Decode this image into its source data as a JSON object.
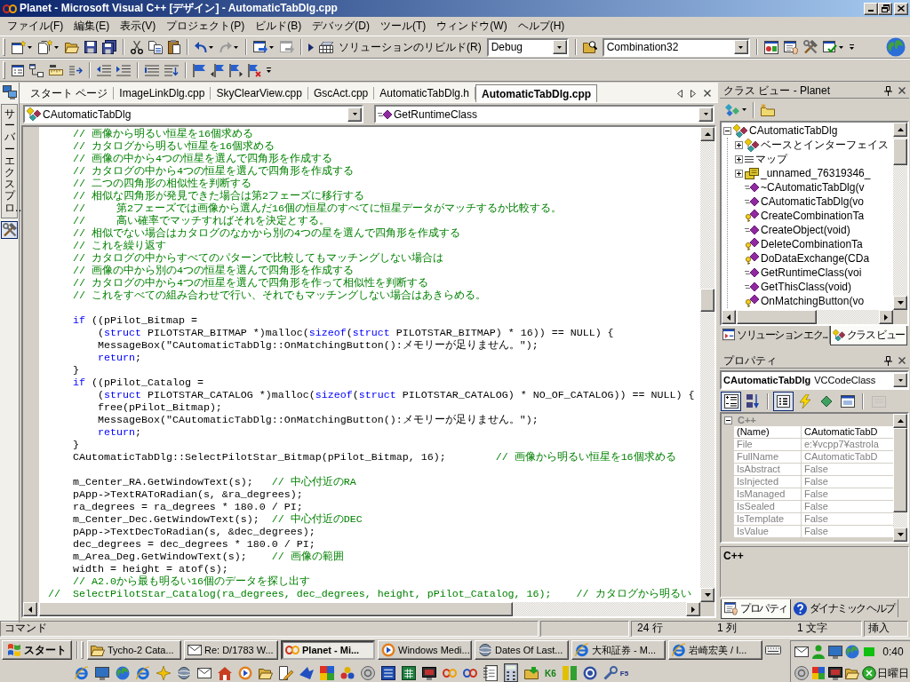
{
  "window": {
    "title": "Planet - Microsoft Visual C++ [デザイン] - AutomaticTabDlg.cpp"
  },
  "menu": [
    "ファイル(F)",
    "編集(E)",
    "表示(V)",
    "プロジェクト(P)",
    "ビルド(B)",
    "デバッグ(D)",
    "ツール(T)",
    "ウィンドウ(W)",
    "ヘルプ(H)"
  ],
  "toolbar": {
    "rebuild": "ソリューションのリビルド(R)",
    "configuration": "Debug",
    "find": "Combination32"
  },
  "side_tab": "サーバーエクスプロ…",
  "editor": {
    "tabs": [
      {
        "label": "スタート ページ",
        "selected": false
      },
      {
        "label": "ImageLinkDlg.cpp",
        "selected": false
      },
      {
        "label": "SkyClearView.cpp",
        "selected": false
      },
      {
        "label": "GscAct.cpp",
        "selected": false
      },
      {
        "label": "AutomaticTabDlg.h",
        "selected": false
      },
      {
        "label": "AutomaticTabDlg.cpp",
        "selected": true
      }
    ],
    "class_combo": "CAutomaticTabDlg",
    "member_combo": "GetRuntimeClass",
    "code_blocks": [
      {
        "lines": [
          {
            "segments": [
              {
                "kind": "comment",
                "text": "    // 画像から明るい恒星を16個求める"
              }
            ]
          },
          {
            "segments": [
              {
                "kind": "comment",
                "text": "    // カタログから明るい恒星を16個求める"
              }
            ]
          },
          {
            "segments": [
              {
                "kind": "comment",
                "text": "    // 画像の中から4つの恒星を選んで四角形を作成する"
              }
            ]
          },
          {
            "segments": [
              {
                "kind": "comment",
                "text": "    // カタログの中から4つの恒星を選んで四角形を作成する"
              }
            ]
          },
          {
            "segments": [
              {
                "kind": "comment",
                "text": "    // 二つの四角形の相似性を判断する"
              }
            ]
          },
          {
            "segments": [
              {
                "kind": "comment",
                "text": "    // 相似な四角形が発見できた場合は第2フェーズに移行する"
              }
            ]
          },
          {
            "segments": [
              {
                "kind": "comment",
                "text": "    //     第2フェーズでは画像から選んだ16個の恒星のすべてに恒星データがマッチするか比較する。"
              }
            ]
          },
          {
            "segments": [
              {
                "kind": "comment",
                "text": "    //     高い確率でマッチすればそれを決定とする。"
              }
            ]
          },
          {
            "segments": [
              {
                "kind": "comment",
                "text": "    // 相似でない場合はカタログのなかから別の4つの星を選んで四角形を作成する"
              }
            ]
          },
          {
            "segments": [
              {
                "kind": "comment",
                "text": "    // これを繰り返す"
              }
            ]
          },
          {
            "segments": [
              {
                "kind": "comment",
                "text": "    // カタログの中からすべてのパターンで比較してもマッチングしない場合は"
              }
            ]
          },
          {
            "segments": [
              {
                "kind": "comment",
                "text": "    // 画像の中から別の4つの恒星を選んで四角形を作成する"
              }
            ]
          },
          {
            "segments": [
              {
                "kind": "comment",
                "text": "    // カタログの中から4つの恒星を選んで四角形を作って相似性を判断する"
              }
            ]
          },
          {
            "segments": [
              {
                "kind": "comment",
                "text": "    // これをすべての組み合わせで行い、それでもマッチングしない場合はあきらめる。"
              }
            ]
          }
        ]
      },
      {
        "lines": [
          {
            "segments": [
              {
                "kind": "keyword",
                "text": "    if"
              },
              {
                "kind": "code",
                "text": " ((pPilot_Bitmap ="
              }
            ]
          },
          {
            "segments": [
              {
                "kind": "code",
                "text": "        ("
              },
              {
                "kind": "keyword",
                "text": "struct"
              },
              {
                "kind": "code",
                "text": " PILOTSTAR_BITMAP *)malloc("
              },
              {
                "kind": "keyword",
                "text": "sizeof"
              },
              {
                "kind": "code",
                "text": "("
              },
              {
                "kind": "keyword",
                "text": "struct"
              },
              {
                "kind": "code",
                "text": " PILOTSTAR_BITMAP) * 16)) == NULL) {"
              }
            ]
          },
          {
            "segments": [
              {
                "kind": "code",
                "text": "        MessageBox(\"CAutomaticTabDlg::OnMatchingButton():メモリーが足りません。\");"
              }
            ]
          },
          {
            "segments": [
              {
                "kind": "keyword",
                "text": "        return"
              },
              {
                "kind": "code",
                "text": ";"
              }
            ]
          },
          {
            "segments": [
              {
                "kind": "code",
                "text": "    }"
              }
            ]
          },
          {
            "segments": [
              {
                "kind": "keyword",
                "text": "    if"
              },
              {
                "kind": "code",
                "text": " ((pPilot_Catalog ="
              }
            ]
          },
          {
            "segments": [
              {
                "kind": "code",
                "text": "        ("
              },
              {
                "kind": "keyword",
                "text": "struct"
              },
              {
                "kind": "code",
                "text": " PILOTSTAR_CATALOG *)malloc("
              },
              {
                "kind": "keyword",
                "text": "sizeof"
              },
              {
                "kind": "code",
                "text": "("
              },
              {
                "kind": "keyword",
                "text": "struct"
              },
              {
                "kind": "code",
                "text": " PILOTSTAR_CATALOG) * NO_OF_CATALOG)) == NULL) {"
              }
            ]
          },
          {
            "segments": [
              {
                "kind": "code",
                "text": "        free(pPilot_Bitmap);"
              }
            ]
          },
          {
            "segments": [
              {
                "kind": "code",
                "text": "        MessageBox(\"CAutomaticTabDlg::OnMatchingButton():メモリーが足りません。\");"
              }
            ]
          },
          {
            "segments": [
              {
                "kind": "keyword",
                "text": "        return"
              },
              {
                "kind": "code",
                "text": ";"
              }
            ]
          },
          {
            "segments": [
              {
                "kind": "code",
                "text": "    }"
              }
            ]
          },
          {
            "segments": [
              {
                "kind": "code",
                "text": "    CAutomaticTabDlg::SelectPilotStar_Bitmap(pPilot_Bitmap, 16);        "
              },
              {
                "kind": "comment",
                "text": "// 画像から明るい恒星を16個求める"
              }
            ]
          }
        ]
      },
      {
        "lines": [
          {
            "segments": [
              {
                "kind": "code",
                "text": "    m_Center_RA.GetWindowText(s);   "
              },
              {
                "kind": "comment",
                "text": "// 中心付近のRA"
              }
            ]
          },
          {
            "segments": [
              {
                "kind": "code",
                "text": "    pApp->TextRAToRadian(s, &ra_degrees);"
              }
            ]
          },
          {
            "segments": [
              {
                "kind": "code",
                "text": "    ra_degrees = ra_degrees * 180.0 / PI;"
              }
            ]
          },
          {
            "segments": [
              {
                "kind": "code",
                "text": "    m_Center_Dec.GetWindowText(s);  "
              },
              {
                "kind": "comment",
                "text": "// 中心付近のDEC"
              }
            ]
          },
          {
            "segments": [
              {
                "kind": "code",
                "text": "    pApp->TextDecToRadian(s, &dec_degrees);"
              }
            ]
          },
          {
            "segments": [
              {
                "kind": "code",
                "text": "    dec_degrees = dec_degrees * 180.0 / PI;"
              }
            ]
          },
          {
            "segments": [
              {
                "kind": "code",
                "text": "    m_Area_Deg.GetWindowText(s);    "
              },
              {
                "kind": "comment",
                "text": "// 画像の範囲"
              }
            ]
          },
          {
            "segments": [
              {
                "kind": "code",
                "text": "    width = height = atof(s);"
              }
            ]
          },
          {
            "segments": [
              {
                "kind": "comment",
                "text": "    // A2.0から最も明るい16個のデータを探し出す"
              }
            ]
          },
          {
            "segments": [
              {
                "kind": "comment",
                "text": "//  SelectPilotStar_Catalog(ra_degrees, dec_degrees, height, pPilot_Catalog, 16);    // カタログから明るい"
              }
            ]
          }
        ]
      }
    ]
  },
  "class_view": {
    "title": "クラス ビュー - Planet",
    "tree": [
      {
        "label": "CAutomaticTabDlg",
        "kind": "class",
        "expanded": true,
        "children": [
          {
            "label": "ベースとインターフェイス",
            "kind": "bases",
            "expanded": false
          },
          {
            "label": "マップ",
            "kind": "map",
            "expanded": false
          },
          {
            "label": "_unnamed_76319346_",
            "kind": "struct",
            "expanded": false
          },
          {
            "label": "~CAutomaticTabDlg(v",
            "kind": "method"
          },
          {
            "label": "CAutomaticTabDlg(vo",
            "kind": "method"
          },
          {
            "label": "CreateCombinationTa",
            "kind": "protected_method"
          },
          {
            "label": "CreateObject(void)",
            "kind": "method"
          },
          {
            "label": "DeleteCombinationTa",
            "kind": "protected_method"
          },
          {
            "label": "DoDataExchange(CDa",
            "kind": "protected_method"
          },
          {
            "label": "GetRuntimeClass(voi",
            "kind": "method"
          },
          {
            "label": "GetThisClass(void)",
            "kind": "method"
          },
          {
            "label": "OnMatchingButton(vo",
            "kind": "protected_method"
          }
        ]
      }
    ],
    "tabs": [
      {
        "label": "ソリューション エク...",
        "selected": false
      },
      {
        "label": "クラス ビュー",
        "selected": true
      }
    ]
  },
  "properties": {
    "title": "プロパティ",
    "object_name": "CAutomaticTabDlg",
    "object_type": "VCCodeClass",
    "tools": [
      {
        "selected": true,
        "disabled": false
      },
      {
        "selected": false,
        "disabled": false
      },
      {
        "selected": true,
        "disabled": false
      },
      {
        "selected": false,
        "disabled": false
      },
      {
        "selected": false,
        "disabled": false
      },
      {
        "selected": false,
        "disabled": false
      },
      {
        "selected": false,
        "disabled": true
      }
    ],
    "category": {
      "label": "C++",
      "expanded": true
    },
    "rows": [
      {
        "name": "(Name)",
        "value": "CAutomaticTabD",
        "readonly": false
      },
      {
        "name": "File",
        "value": "e:¥vcpp7¥astrola",
        "readonly": true
      },
      {
        "name": "FullName",
        "value": "CAutomaticTabD",
        "readonly": true
      },
      {
        "name": "IsAbstract",
        "value": "False",
        "readonly": true
      },
      {
        "name": "IsInjected",
        "value": "False",
        "readonly": true
      },
      {
        "name": "IsManaged",
        "value": "False",
        "readonly": true
      },
      {
        "name": "IsSealed",
        "value": "False",
        "readonly": true
      },
      {
        "name": "IsTemplate",
        "value": "False",
        "readonly": true
      },
      {
        "name": "IsValue",
        "value": "False",
        "readonly": true
      }
    ],
    "description": "C++",
    "tabs": [
      {
        "label": "プロパティ",
        "selected": true
      },
      {
        "label": "ダイナミック ヘルプ",
        "selected": false
      }
    ]
  },
  "status_bar": {
    "message": "コマンド",
    "line": "24 行",
    "column": "1 列",
    "char": "1 文字",
    "mode": "挿入"
  },
  "taskbar": {
    "start": "スタート",
    "tasks": [
      {
        "label": "Tycho-2 Cata...",
        "selected": false
      },
      {
        "label": "Re: D/1783 W...",
        "selected": false
      },
      {
        "label": "Planet - Mi...",
        "selected": true
      },
      {
        "label": "Windows Medi...",
        "selected": false
      },
      {
        "label": "Dates Of Last...",
        "selected": false
      },
      {
        "label": "大和証券 - M...",
        "selected": false
      },
      {
        "label": "岩崎宏美 / I...",
        "selected": false
      }
    ],
    "quick_launch_labels": [
      "K6",
      "F5"
    ],
    "clock": "0:40",
    "day": "日曜日"
  }
}
